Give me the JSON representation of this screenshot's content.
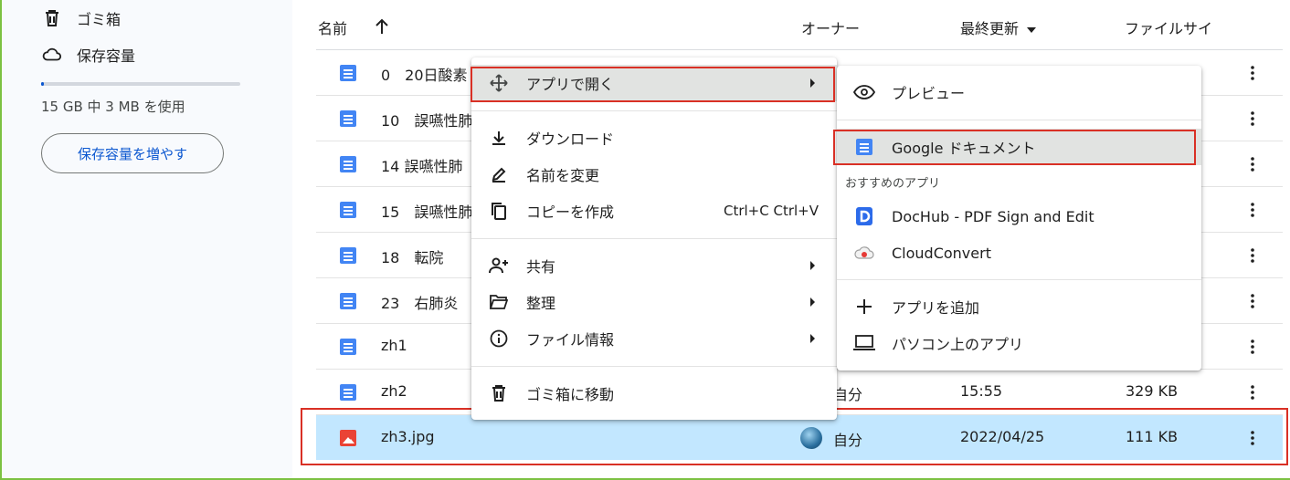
{
  "sidebar": {
    "trash_label": "ゴミ箱",
    "storage_label": "保存容量",
    "storage_usage": "15 GB 中 3 MB を使用",
    "storage_fraction": 0.0002,
    "upgrade_button": "保存容量を増やす"
  },
  "header": {
    "name": "名前",
    "owner": "オーナー",
    "modified": "最終更新",
    "size": "ファイルサイ"
  },
  "files": [
    {
      "name": "0　20日酸素",
      "type": "doc",
      "owner": "",
      "modified": "",
      "size": ""
    },
    {
      "name": "10　誤嚥性肺",
      "type": "doc",
      "owner": "",
      "modified": "",
      "size": ""
    },
    {
      "name": "14 誤嚥性肺",
      "type": "doc",
      "owner": "",
      "modified": "",
      "size": ""
    },
    {
      "name": "15　誤嚥性肺",
      "type": "doc",
      "owner": "",
      "modified": "",
      "size": ""
    },
    {
      "name": "18　転院",
      "type": "doc",
      "owner": "",
      "modified": "",
      "size": ""
    },
    {
      "name": "23　右肺炎",
      "type": "doc",
      "owner": "",
      "modified": "",
      "size": ""
    },
    {
      "name": "zh1",
      "type": "doc",
      "owner": "",
      "modified": "",
      "size": ""
    },
    {
      "name": "zh2",
      "type": "doc",
      "owner": "自分",
      "modified": "15:55",
      "size": "329 KB"
    },
    {
      "name": "zh3.jpg",
      "type": "image",
      "owner": "自分",
      "modified": "2022/04/25",
      "size": "111 KB",
      "selected": true
    }
  ],
  "context_menu": {
    "open_with": "アプリで開く",
    "download": "ダウンロード",
    "rename": "名前を変更",
    "copy": "コピーを作成",
    "copy_shortcut": "Ctrl+C Ctrl+V",
    "share": "共有",
    "organize": "整理",
    "file_info": "ファイル情報",
    "trash": "ゴミ箱に移動"
  },
  "open_with_menu": {
    "preview": "プレビュー",
    "google_docs": "Google ドキュメント",
    "suggested_header": "おすすめのアプリ",
    "dochub": "DocHub - PDF Sign and Edit",
    "cloudconvert": "CloudConvert",
    "add_app": "アプリを追加",
    "computer_apps": "パソコン上のアプリ"
  },
  "colors": {
    "selected_row": "#c2e7ff",
    "accent_blue": "#0b57d0",
    "highlight_red": "#d93025",
    "doc_blue": "#4285f4",
    "image_red": "#ea4335"
  }
}
